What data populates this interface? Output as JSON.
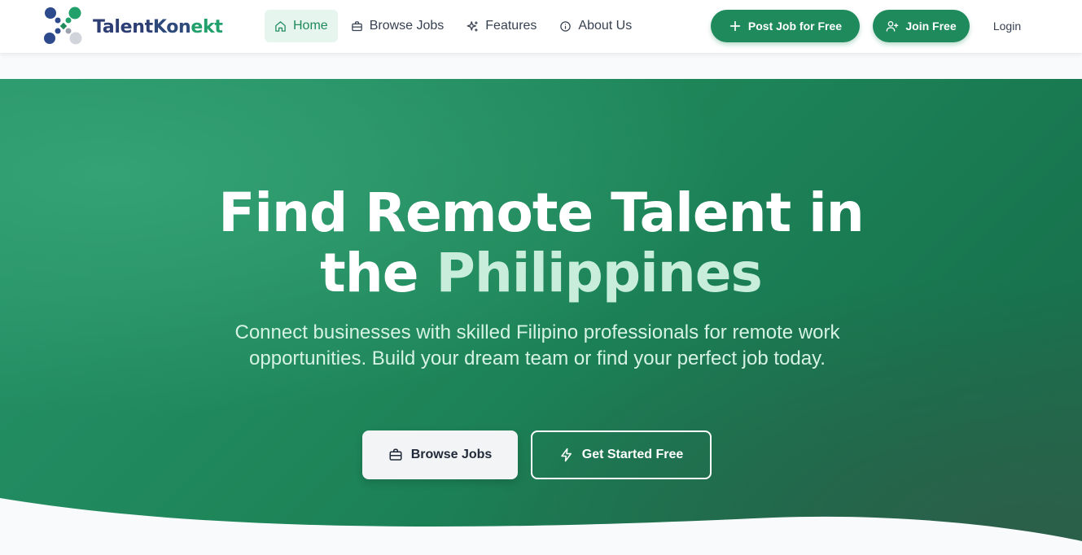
{
  "brand": {
    "part1": "Talent",
    "part2": "Kon",
    "part3": "ekt"
  },
  "nav": {
    "items": [
      {
        "label": "Home",
        "icon": "home-icon",
        "active": true
      },
      {
        "label": "Browse Jobs",
        "icon": "briefcase-icon",
        "active": false
      },
      {
        "label": "Features",
        "icon": "sparkles-icon",
        "active": false
      },
      {
        "label": "About Us",
        "icon": "info-icon",
        "active": false
      }
    ],
    "post_job_label": "Post Job for Free",
    "join_label": "Join Free",
    "login_label": "Login"
  },
  "hero": {
    "title_line1": "Find Remote Talent in",
    "title_line2_prefix": "the ",
    "title_line2_highlight": "Philippines",
    "subtitle": "Connect businesses with skilled Filipino professionals for remote work opportunities. Build your dream team or find your perfect job today.",
    "browse_label": "Browse Jobs",
    "start_label": "Get Started Free"
  },
  "colors": {
    "brand_green": "#1f8a5c",
    "hero_highlight": "#c8eedb",
    "nav_active_bg": "#e6f5ee"
  }
}
